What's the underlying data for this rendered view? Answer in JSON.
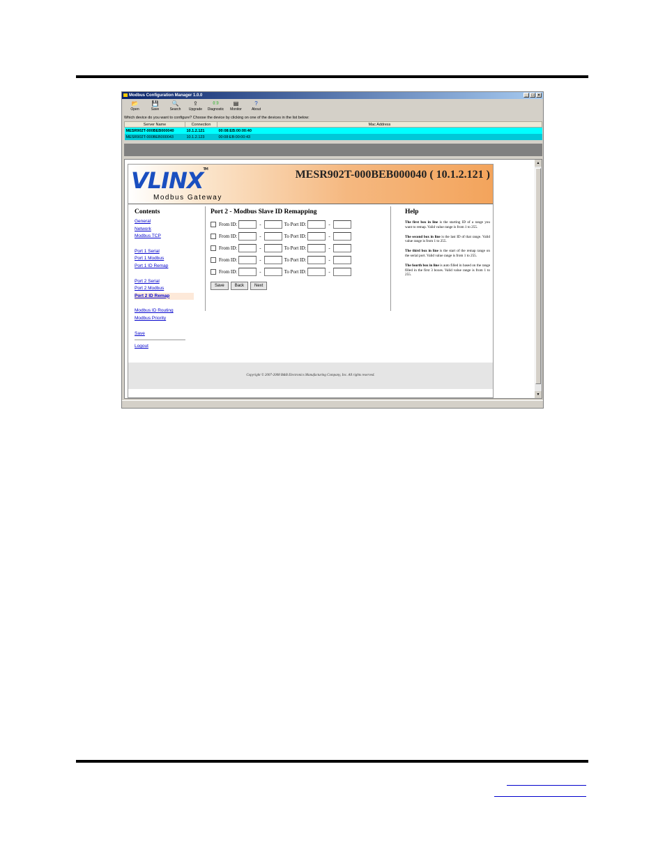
{
  "window": {
    "title": "Modbus Configuration Manager 1.0.0",
    "controls": [
      "_",
      "□",
      "×"
    ]
  },
  "toolbar": {
    "items": [
      {
        "label": "Open",
        "icon": "open-folder-icon",
        "glyph": "📂"
      },
      {
        "label": "Save",
        "icon": "disk-icon",
        "glyph": "💾"
      },
      {
        "label": "Search",
        "icon": "magnifier-icon",
        "glyph": "🔍"
      },
      {
        "label": "Upgrade",
        "icon": "upgrade-icon",
        "glyph": "⇪"
      },
      {
        "label": "Diagnostic",
        "icon": "diagnostic-icon",
        "glyph": "((·))"
      },
      {
        "label": "Monitor",
        "icon": "monitor-icon",
        "glyph": "▤"
      },
      {
        "label": "About",
        "icon": "question-icon",
        "glyph": "?"
      }
    ]
  },
  "prompt": "Which device do you want to configure? Choose the device by clicking on one of the devices in the list below:",
  "device_table": {
    "headers": [
      "Server Name",
      "Connection",
      "Mac Address"
    ],
    "rows": [
      [
        "MESR902T-000BEB000040",
        "10.1.2.121",
        "00:08:EB:00:00:40"
      ],
      [
        "MESR902T-000BEB000043",
        "10.1.2.123",
        "00:08:EB:00:00:43"
      ]
    ]
  },
  "banner": {
    "logo": "VLINX",
    "trademark": "TM",
    "subtitle": "Modbus Gateway",
    "device_title": "MESR902T-000BEB000040 ( 10.1.2.121 )"
  },
  "sidebar": {
    "heading": "Contents",
    "links": [
      "General",
      "Network",
      "Modbus TCP",
      "Port 1 Serial",
      "Port 1 Modbus",
      "Port 1 ID Remap",
      "Port 2 Serial",
      "Port 2 Modbus",
      "Port 2 ID Remap",
      "Modbus ID Routing",
      "Modbus Priority",
      "Save",
      "Logout"
    ]
  },
  "main": {
    "heading": "Port 2 - Modbus Slave ID Remapping",
    "from_label": "From ID:",
    "to_label": "To Port ID:",
    "dash": "-",
    "buttons": {
      "save": "Save",
      "back": "Back",
      "next": "Next"
    }
  },
  "help": {
    "heading": "Help",
    "p1_bold": "The first box in line",
    "p1_rest": " is the starting ID of a range you want to remap. Valid value range is from 1 to 255.",
    "p2_bold": "The second box in line",
    "p2_rest": " is the last ID of that range. Valid value range is from 1 to 255.",
    "p3_bold": "The third box in line",
    "p3_rest": " is the start of the remap range on the serial port. Valid value range is from 1 to 255.",
    "p4_bold": "The fourth box in line",
    "p4_rest": " is auto filled in based on the range filled in the first 3 boxes. Valid value range is from 1 to 255."
  },
  "footer": "Copyright © 2007-2008 B&B Electronics Manufacturing Company, Inc. All rights reserved."
}
